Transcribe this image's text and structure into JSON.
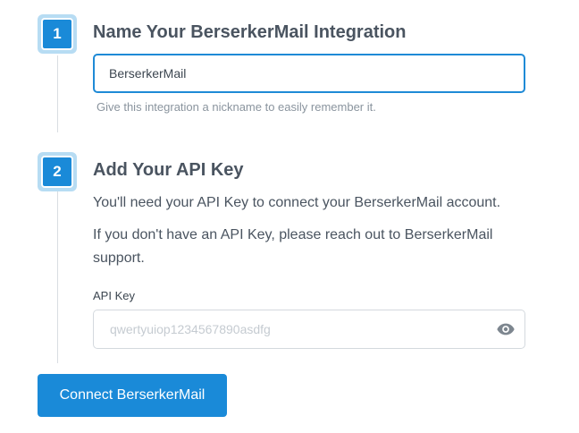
{
  "step1": {
    "number": "1",
    "title": "Name Your BerserkerMail Integration",
    "name_value": "BerserkerMail",
    "help": "Give this integration a nickname to easily remember it."
  },
  "step2": {
    "number": "2",
    "title": "Add Your API Key",
    "para1": "You'll need your API Key to connect your BerserkerMail account.",
    "para2": "If you don't have an API Key, please reach out to BerserkerMail support.",
    "api_key_label": "API Key",
    "api_key_placeholder": "qwertyuiop1234567890asdfg",
    "api_key_value": "",
    "icon": "eye-icon"
  },
  "actions": {
    "connect_label": "Connect BerserkerMail"
  },
  "colors": {
    "accent": "#1a8ad8",
    "badge_ring": "#b7dcf3"
  }
}
